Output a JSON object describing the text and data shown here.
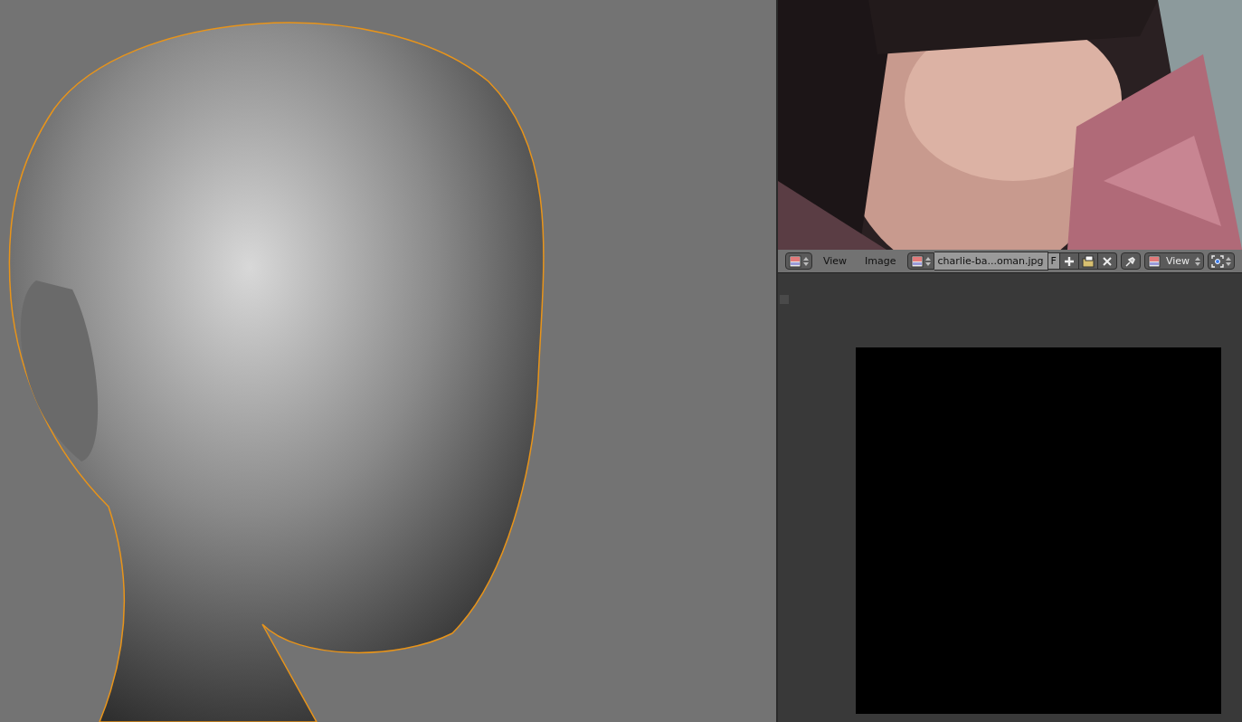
{
  "image_editor": {
    "header": {
      "menus": [
        "View",
        "Image"
      ],
      "image_name": "charlie-ba...oman.jpg",
      "fake_user": "F",
      "view_menu": "View"
    }
  }
}
